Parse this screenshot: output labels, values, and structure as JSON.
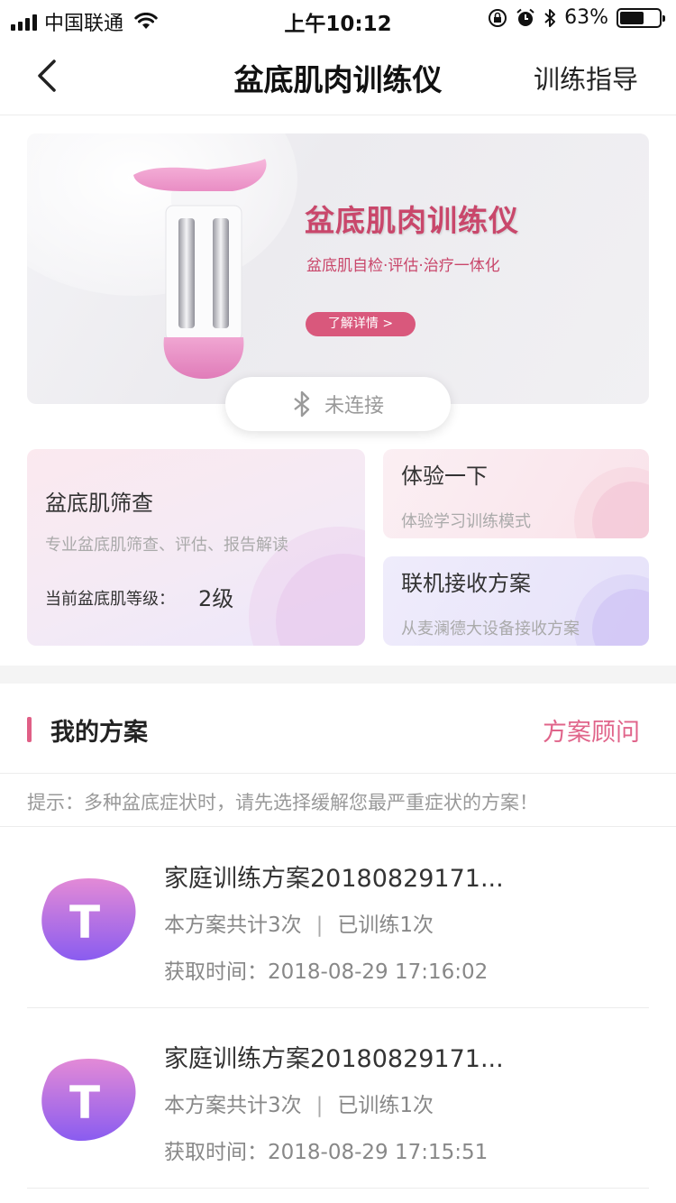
{
  "status_bar": {
    "carrier": "中国联通",
    "time": "上午10:12",
    "battery_percent_text": "63%",
    "battery_level": 0.63
  },
  "nav": {
    "title": "盆底肌肉训练仪",
    "action": "训练指导"
  },
  "banner": {
    "title": "盆底肌肉训练仪",
    "subtitle": "盆底肌自检·评估·治疗一体化",
    "button": "了解详情 >"
  },
  "connection": {
    "status": "未连接",
    "icon": "bluetooth-icon"
  },
  "cards": {
    "screening": {
      "title": "盆底肌筛查",
      "subtitle": "专业盆底肌筛查、评估、报告解读",
      "level_label": "当前盆底肌等级：",
      "level_value": "2级"
    },
    "experience": {
      "title": "体验一下",
      "subtitle": "体验学习训练模式"
    },
    "online": {
      "title": "联机接收方案",
      "subtitle": "从麦澜德大设备接收方案"
    }
  },
  "plans_section": {
    "title": "我的方案",
    "advisor_link": "方案顾问",
    "tip": "提示：多种盆底症状时，请先选择缓解您最严重症状的方案！"
  },
  "plans": [
    {
      "avatar_letter": "T",
      "title": "家庭训练方案20180829171...",
      "total": "本方案共计3次",
      "separator": "|",
      "done": "已训练1次",
      "time_label": "获取时间：",
      "time": "2018-08-29 17:16:02"
    },
    {
      "avatar_letter": "T",
      "title": "家庭训练方案20180829171...",
      "total": "本方案共计3次",
      "separator": "|",
      "done": "已训练1次",
      "time_label": "获取时间：",
      "time": "2018-08-29 17:15:51"
    }
  ],
  "colors": {
    "accent": "#e0648a",
    "banner_text": "#c9476b",
    "avatar_top": "#e38ad6",
    "avatar_bottom": "#8a5cf0"
  }
}
